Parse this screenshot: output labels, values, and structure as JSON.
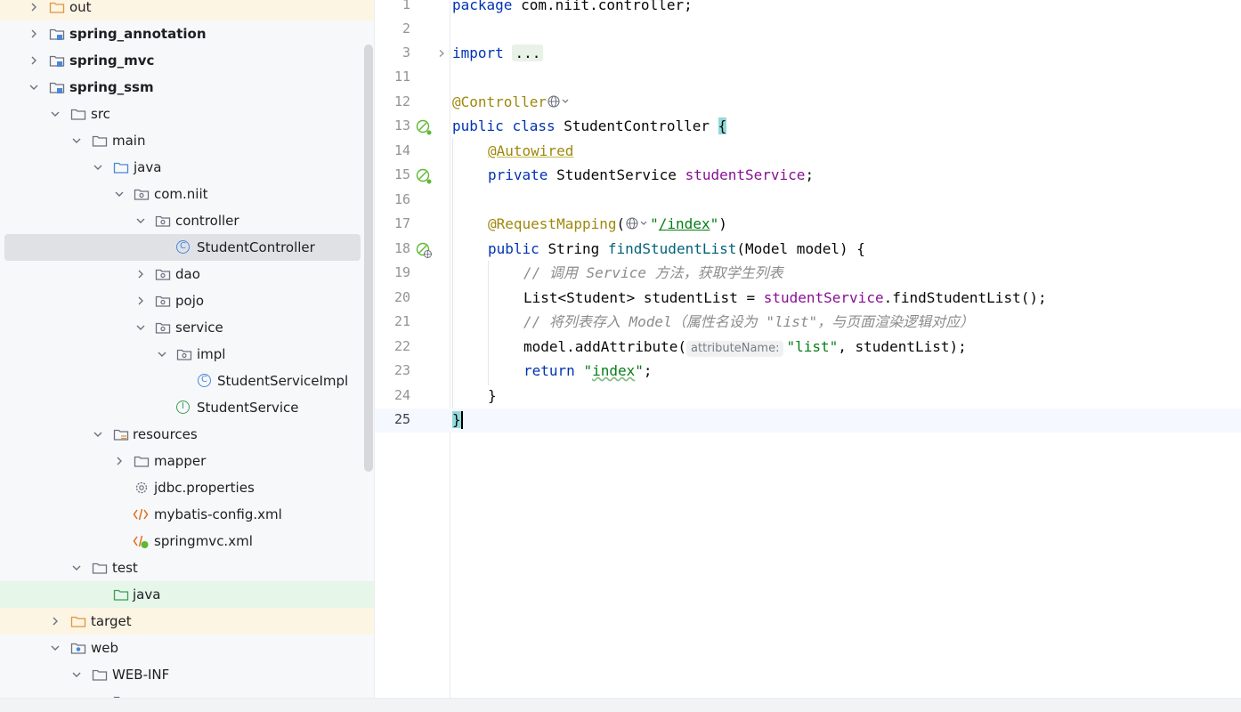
{
  "project_tree": {
    "rows": [
      {
        "label": "out",
        "bold": false,
        "icon": "folder-icon",
        "chevron": "right"
      },
      {
        "label": "spring_annotation",
        "bold": true,
        "icon": "module-folder-icon",
        "chevron": "right"
      },
      {
        "label": "spring_mvc",
        "bold": true,
        "icon": "module-folder-icon",
        "chevron": "right"
      },
      {
        "label": "spring_ssm",
        "bold": true,
        "icon": "module-folder-icon",
        "chevron": "down"
      },
      {
        "label": "src",
        "bold": false,
        "icon": "folder-icon",
        "chevron": "down"
      },
      {
        "label": "main",
        "bold": false,
        "icon": "folder-icon",
        "chevron": "down"
      },
      {
        "label": "java",
        "bold": false,
        "icon": "source-folder-icon",
        "chevron": "down"
      },
      {
        "label": "com.niit",
        "bold": false,
        "icon": "package-icon",
        "chevron": "down"
      },
      {
        "label": "controller",
        "bold": false,
        "icon": "package-icon",
        "chevron": "down"
      },
      {
        "label": "StudentController",
        "bold": false,
        "icon": "java-class-icon",
        "chevron": "none"
      },
      {
        "label": "dao",
        "bold": false,
        "icon": "package-icon",
        "chevron": "right"
      },
      {
        "label": "pojo",
        "bold": false,
        "icon": "package-icon",
        "chevron": "right"
      },
      {
        "label": "service",
        "bold": false,
        "icon": "package-icon",
        "chevron": "down"
      },
      {
        "label": "impl",
        "bold": false,
        "icon": "package-icon",
        "chevron": "down"
      },
      {
        "label": "StudentServiceImpl",
        "bold": false,
        "icon": "java-class-icon",
        "chevron": "none"
      },
      {
        "label": "StudentService",
        "bold": false,
        "icon": "java-interface-icon",
        "chevron": "none"
      },
      {
        "label": "resources",
        "bold": false,
        "icon": "resources-folder-icon",
        "chevron": "down"
      },
      {
        "label": "mapper",
        "bold": false,
        "icon": "folder-icon",
        "chevron": "right"
      },
      {
        "label": "jdbc.properties",
        "bold": false,
        "icon": "properties-gear-icon",
        "chevron": "none"
      },
      {
        "label": "mybatis-config.xml",
        "bold": false,
        "icon": "xml-file-icon",
        "chevron": "none"
      },
      {
        "label": "springmvc.xml",
        "bold": false,
        "icon": "spring-xml-file-icon",
        "chevron": "none"
      },
      {
        "label": "test",
        "bold": false,
        "icon": "folder-icon",
        "chevron": "down"
      },
      {
        "label": "java",
        "bold": false,
        "icon": "test-source-folder-icon",
        "chevron": "none"
      },
      {
        "label": "target",
        "bold": false,
        "icon": "excluded-folder-icon",
        "chevron": "right"
      },
      {
        "label": "web",
        "bold": false,
        "icon": "web-folder-icon",
        "chevron": "down"
      },
      {
        "label": "WEB-INF",
        "bold": false,
        "icon": "folder-icon",
        "chevron": "down"
      }
    ]
  },
  "editor": {
    "current_line": "25",
    "lines": [
      {
        "n": "1",
        "text_package": "package",
        "text_rest": " com.niit.controller;"
      },
      {
        "n": "2"
      },
      {
        "n": "3",
        "kw": "import",
        "folded": "..."
      },
      {
        "n": "11"
      },
      {
        "n": "12",
        "ann": "@Controller"
      },
      {
        "n": "13",
        "kw1": "public",
        "kw2": "class",
        "name": "StudentController",
        "brace": "{"
      },
      {
        "n": "14",
        "ann": "@Autowired"
      },
      {
        "n": "15",
        "kw": "private",
        "type": "StudentService",
        "field": "studentService",
        "end": ";"
      },
      {
        "n": "16"
      },
      {
        "n": "17",
        "ann": "@RequestMapping",
        "open": "(",
        "q1": "\"",
        "path": "/index",
        "q2": "\"",
        "close": ")"
      },
      {
        "n": "18",
        "kw": "public",
        "type": "String",
        "method": "findStudentList",
        "params": "(Model model) {"
      },
      {
        "n": "19",
        "comment": "// 调用 Service 方法，获取学生列表"
      },
      {
        "n": "20",
        "lhs": "List<Student> studentList = ",
        "field": "studentService",
        "rhs": ".findStudentList();"
      },
      {
        "n": "21",
        "comment": "// 将列表存入 Model（属性名设为 \"list\"，与页面渲染逻辑对应）"
      },
      {
        "n": "22",
        "call": "model.addAttribute(",
        "hint": "attributeName:",
        "str": "\"list\"",
        "rest": ", studentList);"
      },
      {
        "n": "23",
        "kw": "return",
        "q1": "\"",
        "word": "index",
        "q2": "\"",
        "end": ";"
      },
      {
        "n": "24",
        "text": "}"
      },
      {
        "n": "25",
        "text": "}"
      }
    ]
  },
  "colors": {
    "keyword": "#0033b3",
    "annotation": "#9e880d",
    "string": "#067d17",
    "field": "#871094",
    "method": "#00627a",
    "comment": "#8c8c8c"
  }
}
